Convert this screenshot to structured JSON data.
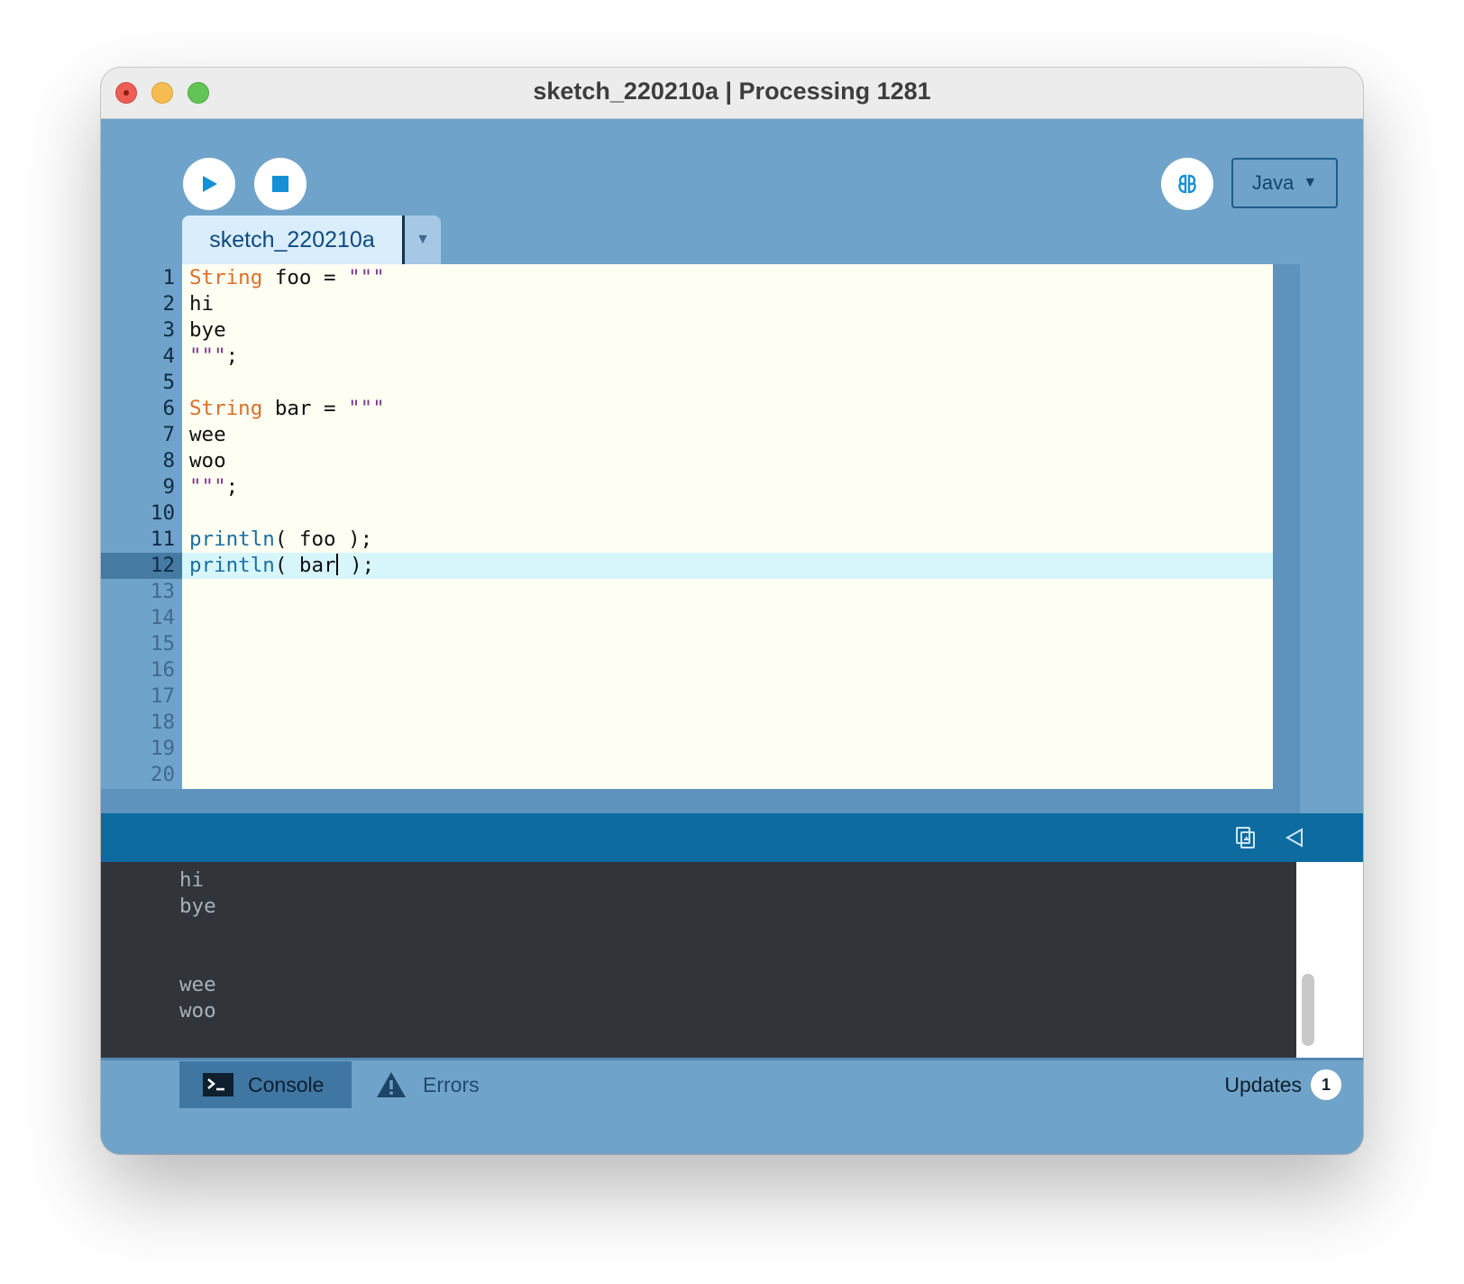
{
  "window": {
    "title": "sketch_220210a | Processing 1281"
  },
  "toolbar": {
    "run_icon": "play-icon",
    "stop_icon": "stop-icon",
    "debug_icon": "butterfly-debug-icon",
    "mode_label": "Java",
    "mode_arrow": "▼"
  },
  "tabs": {
    "active_label": "sketch_220210a",
    "menu_arrow": "▼"
  },
  "editor": {
    "active_line": 12,
    "line_numbers": [
      "1",
      "2",
      "3",
      "4",
      "5",
      "6",
      "7",
      "8",
      "9",
      "10",
      "11",
      "12",
      "13",
      "14",
      "15",
      "16",
      "17",
      "18",
      "19",
      "20"
    ],
    "lines": [
      [
        {
          "t": "String",
          "c": "kw"
        },
        {
          "t": " foo = ",
          "c": ""
        },
        {
          "t": "\"\"\"",
          "c": "str"
        }
      ],
      [
        {
          "t": "hi",
          "c": ""
        }
      ],
      [
        {
          "t": "bye",
          "c": ""
        }
      ],
      [
        {
          "t": "\"\"\"",
          "c": "str"
        },
        {
          "t": ";",
          "c": ""
        }
      ],
      [],
      [
        {
          "t": "String",
          "c": "kw"
        },
        {
          "t": " bar = ",
          "c": ""
        },
        {
          "t": "\"\"\"",
          "c": "str"
        }
      ],
      [
        {
          "t": "wee",
          "c": ""
        }
      ],
      [
        {
          "t": "woo",
          "c": ""
        }
      ],
      [
        {
          "t": "\"\"\"",
          "c": "str"
        },
        {
          "t": ";",
          "c": ""
        }
      ],
      [],
      [
        {
          "t": "println",
          "c": "fn"
        },
        {
          "t": "( foo );",
          "c": ""
        }
      ],
      [
        {
          "t": "println",
          "c": "fn"
        },
        {
          "t": "( bar",
          "c": ""
        },
        {
          "t": "|cursor|",
          "c": "cursor"
        },
        {
          "t": " );",
          "c": ""
        }
      ]
    ]
  },
  "console": {
    "copy_icon": "copy-icon",
    "collapse_icon": "collapse-triangle-icon",
    "lines": [
      "hi",
      "bye",
      "",
      "",
      "wee",
      "woo"
    ]
  },
  "footer": {
    "console_label": "Console",
    "errors_label": "Errors",
    "updates_label": "Updates",
    "updates_count": "1"
  },
  "colors": {
    "frame": "#6fa3c9",
    "editor_bg": "#fefef2",
    "active_line": "#d6f6fc",
    "keyword": "#d96f2a",
    "string": "#7c3a91",
    "function": "#1a6fa3",
    "console_bg": "#31353a",
    "console_header": "#0d6ba0"
  }
}
